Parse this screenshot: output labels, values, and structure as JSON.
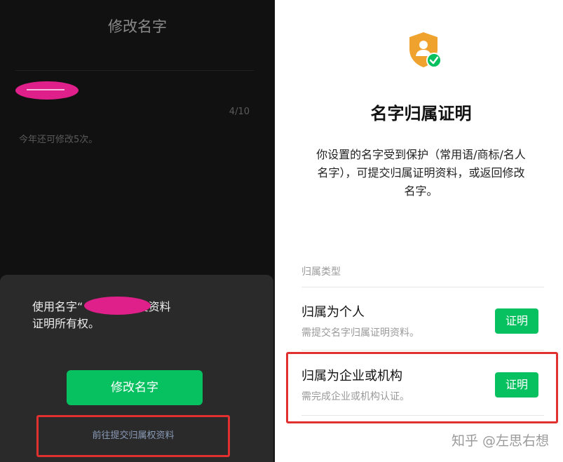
{
  "left": {
    "title": "修改名字",
    "counter": "4/10",
    "remaining_text": "今年还可修改5次。",
    "sheet": {
      "message_line1": "使用名字“           ”，需要提交资料",
      "message_line2": "证明所有权。",
      "primary_button": "修改名字",
      "link_button": "前往提交归属权资料"
    }
  },
  "right": {
    "title": "名字归属证明",
    "description_line1": "你设置的名字受到保护（常用语/商标/名人",
    "description_line2": "名字），可提交归属证明资料，或返回修改",
    "description_line3": "名字。",
    "section_label": "归属类型",
    "options": [
      {
        "title": "归属为个人",
        "subtitle": "需提交名字归属证明资料。",
        "button": "证明"
      },
      {
        "title": "归属为企业或机构",
        "subtitle": "需完成企业或机构认证。",
        "button": "证明"
      }
    ],
    "watermark": "知乎 @左思右想"
  },
  "colors": {
    "accent_green": "#07c160",
    "highlight_red": "#e03030",
    "redaction_pink": "#e0208a",
    "shield_orange": "#f0a22e"
  },
  "icons": {
    "shield": "shield-user-check-icon"
  }
}
